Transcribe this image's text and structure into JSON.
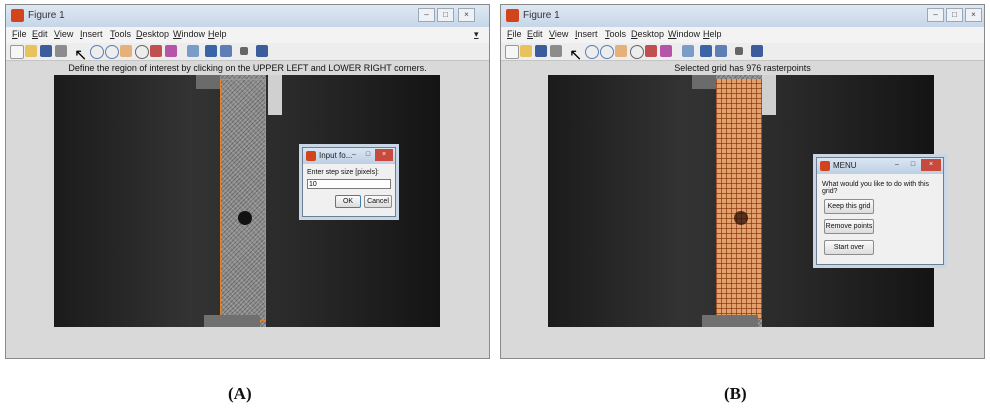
{
  "menu_items": [
    "File",
    "Edit",
    "View",
    "Insert",
    "Tools",
    "Desktop",
    "Window",
    "Help"
  ],
  "colors": {
    "roi_outline": "#e8832b",
    "grid_fill": "#e2a06c",
    "titlebar": "#c6d6e8",
    "app_icon": "#d2451c"
  },
  "panel_a": {
    "window_title": "Figure 1",
    "plot_title": "Define the region of interest by clicking on the UPPER LEFT and LOWER RIGHT corners.",
    "dialog": {
      "title": "Input fo...",
      "prompt": "Enter step size [pixels]:",
      "input_value": "10",
      "ok_label": "OK",
      "cancel_label": "Cancel"
    },
    "caption": "(A)"
  },
  "panel_b": {
    "window_title": "Figure 1",
    "plot_title": "Selected grid has 976 rasterpoints",
    "dialog": {
      "title": "MENU",
      "prompt": "What would you like to do with this grid?",
      "buttons": [
        "Keep this grid",
        "Remove points",
        "Start over"
      ]
    },
    "caption": "(B)"
  }
}
